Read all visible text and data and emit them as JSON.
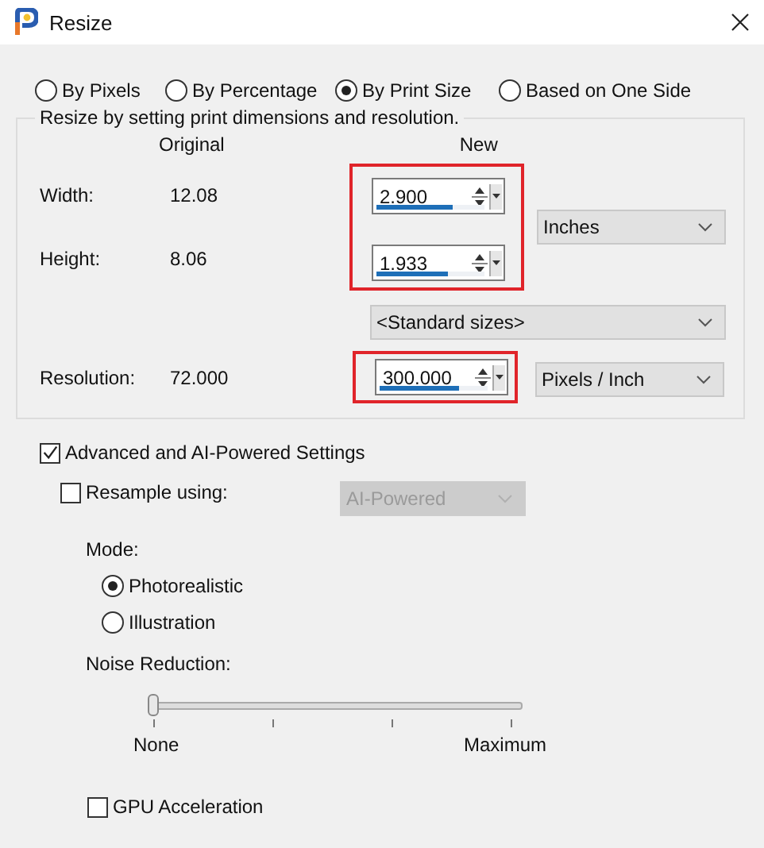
{
  "window": {
    "title": "Resize"
  },
  "modes": [
    {
      "label": "By Pixels",
      "selected": false
    },
    {
      "label": "By Percentage",
      "selected": false
    },
    {
      "label": "By Print Size",
      "selected": true
    },
    {
      "label": "Based on One Side",
      "selected": false
    }
  ],
  "group": {
    "caption": "Resize by setting print dimensions and resolution.",
    "column_headers": [
      "Original",
      "New"
    ],
    "rows": [
      {
        "label": "Width:",
        "original": "12.08",
        "value": "2.900",
        "level": 0.71
      },
      {
        "label": "Height:",
        "original": "8.06",
        "value": "1.933",
        "level": 0.66
      }
    ],
    "units": "Inches",
    "standard_sizes": "<Standard sizes>",
    "resolution": {
      "label": "Resolution:",
      "original": "72.000",
      "value": "300.000",
      "level": 0.73
    },
    "resolution_units": "Pixels / Inch"
  },
  "advanced": {
    "label": "Advanced and AI-Powered Settings",
    "checked": true
  },
  "resample": {
    "label": "Resample using:",
    "checked": false,
    "method": "AI-Powered",
    "disabled": true
  },
  "mode": {
    "label": "Mode:",
    "options": [
      {
        "label": "Photorealistic",
        "selected": true
      },
      {
        "label": "Illustration",
        "selected": false
      }
    ]
  },
  "noise": {
    "label": "Noise Reduction:",
    "level": 0,
    "min_label": "None",
    "max_label": "Maximum"
  },
  "gpu": {
    "label": "GPU Acceleration",
    "checked": false
  }
}
